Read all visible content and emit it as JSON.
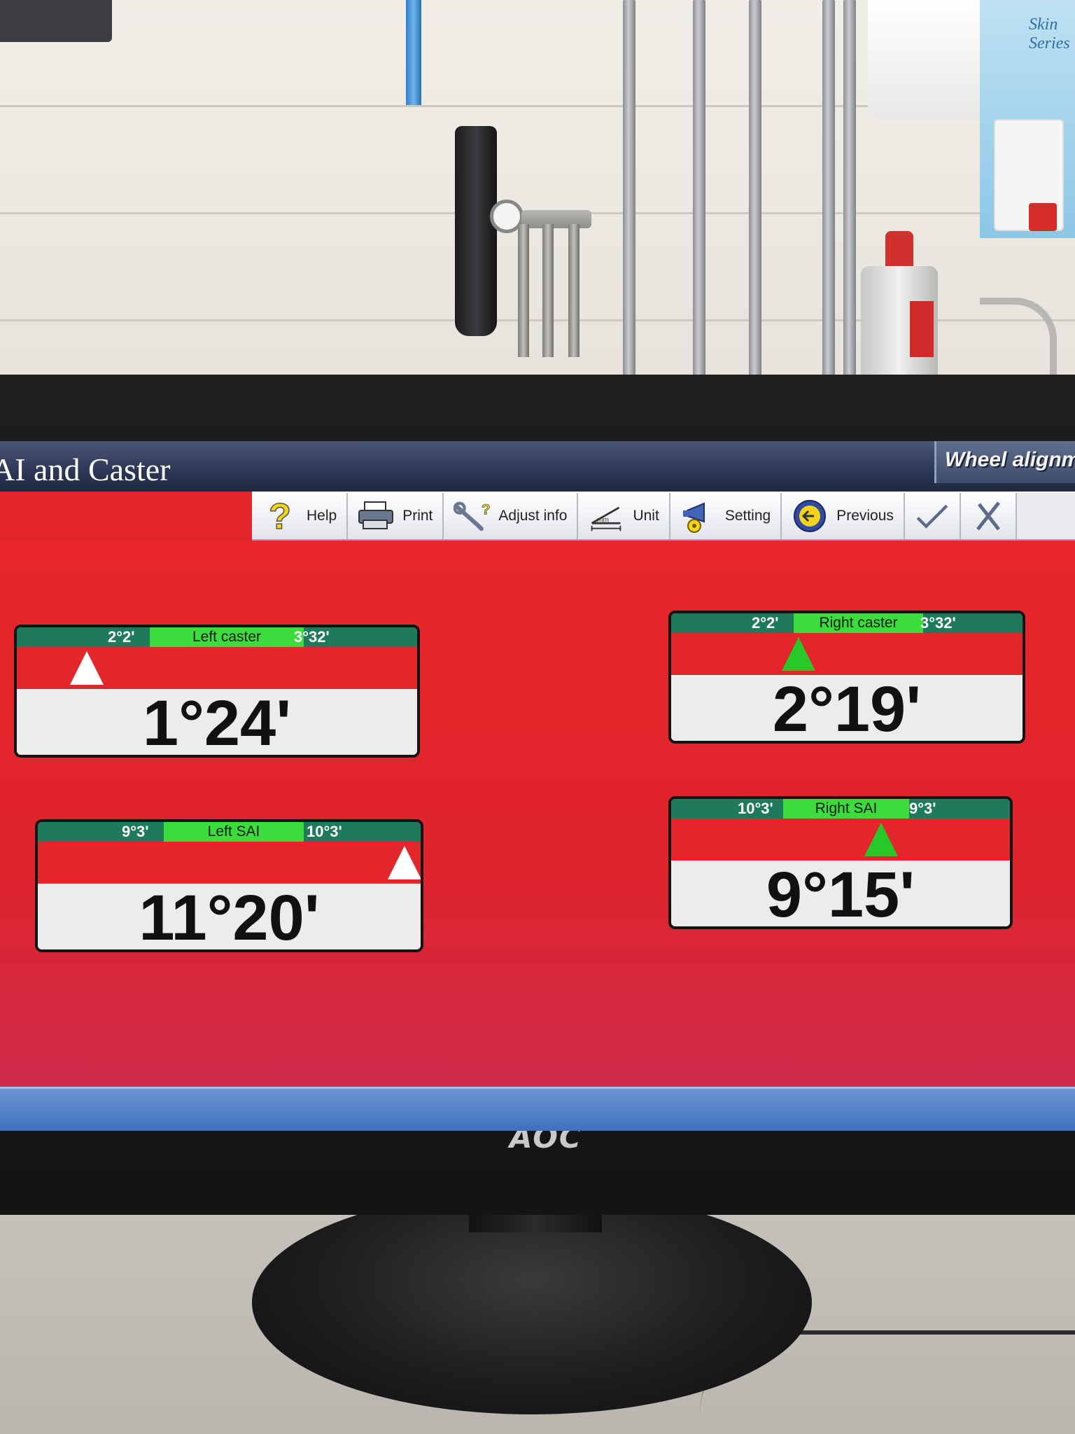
{
  "app": {
    "title": "AI and Caster",
    "brand": "Wheel alignment"
  },
  "toolbar": {
    "items": [
      {
        "label": "Help",
        "icon": "help-question-icon"
      },
      {
        "label": "Print",
        "icon": "printer-icon"
      },
      {
        "label": "Adjust info",
        "icon": "wrench-icon"
      },
      {
        "label": "Unit",
        "icon": "ruler-angle-icon"
      },
      {
        "label": "Setting",
        "icon": "megaphone-gear-icon"
      },
      {
        "label": "Previous",
        "icon": "arrow-left-icon"
      },
      {
        "label": "",
        "icon": "checkmark-icon"
      },
      {
        "label": "",
        "icon": "close-x-icon"
      }
    ]
  },
  "gauges": [
    {
      "id": "left-caster",
      "name": "Left caster",
      "min": "2°2'",
      "max": "3°32'",
      "value": "1°24'",
      "marker_color": "white",
      "marker_position": 0.12
    },
    {
      "id": "right-caster",
      "name": "Right caster",
      "min": "2°2'",
      "max": "3°32'",
      "value": "2°19'",
      "marker_color": "green",
      "marker_position": 0.36
    },
    {
      "id": "left-sai",
      "name": "Left SAI",
      "min": "9°3'",
      "max": "10°3'",
      "value": "11°20'",
      "marker_color": "white",
      "marker_position": 0.97
    },
    {
      "id": "right-sai",
      "name": "Right SAI",
      "min": "10°3'",
      "max": "9°3'",
      "value": "9°15'",
      "marker_color": "green",
      "marker_position": 0.62
    }
  ],
  "monitor": {
    "brand": "AOC"
  },
  "background": {
    "sign_text": "Skin Series"
  },
  "colors": {
    "screen_red": "#e3262c",
    "tolerance_green": "#3cdc3c",
    "range_bar": "#1e7a5a",
    "titlebar": "#2c3755"
  }
}
